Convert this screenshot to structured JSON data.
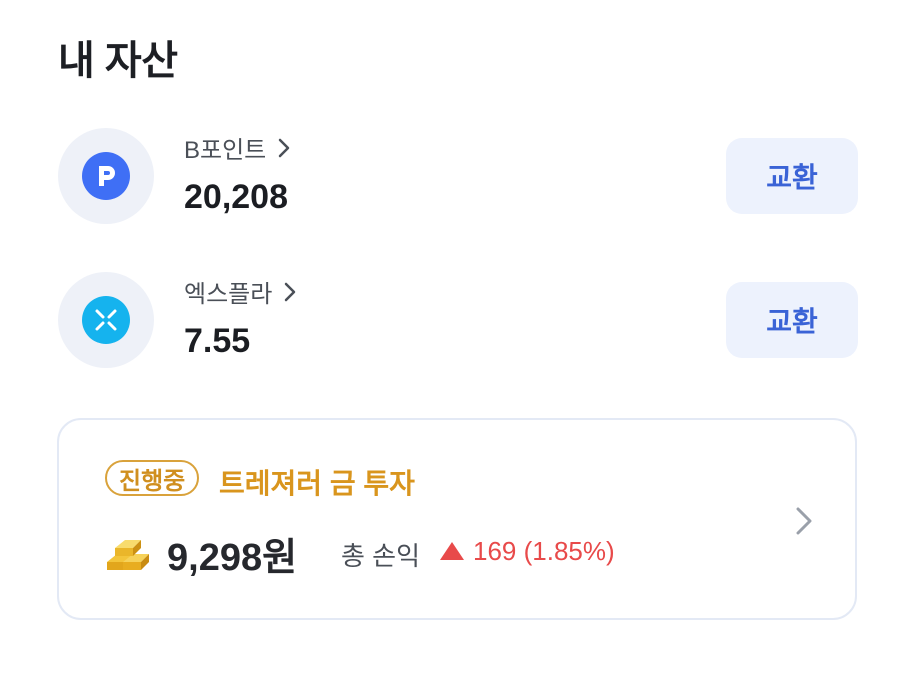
{
  "page": {
    "title": "내 자산"
  },
  "assets": [
    {
      "name": "B포인트",
      "value": "20,208",
      "icon": "p-point-icon",
      "exchange_label": "교환",
      "icon_color": "#3f6ff5"
    },
    {
      "name": "엑스플라",
      "value": "7.55",
      "icon": "xpla-icon",
      "exchange_label": "교환",
      "icon_color": "#15b3ee"
    }
  ],
  "investment": {
    "status": "진행중",
    "title": "트레져러 금 투자",
    "amount": "9,298원",
    "profit_label": "총 손익",
    "profit_value": "169 (1.85%)",
    "profit_color": "#e84a4a",
    "accent_color": "#d9951d"
  }
}
